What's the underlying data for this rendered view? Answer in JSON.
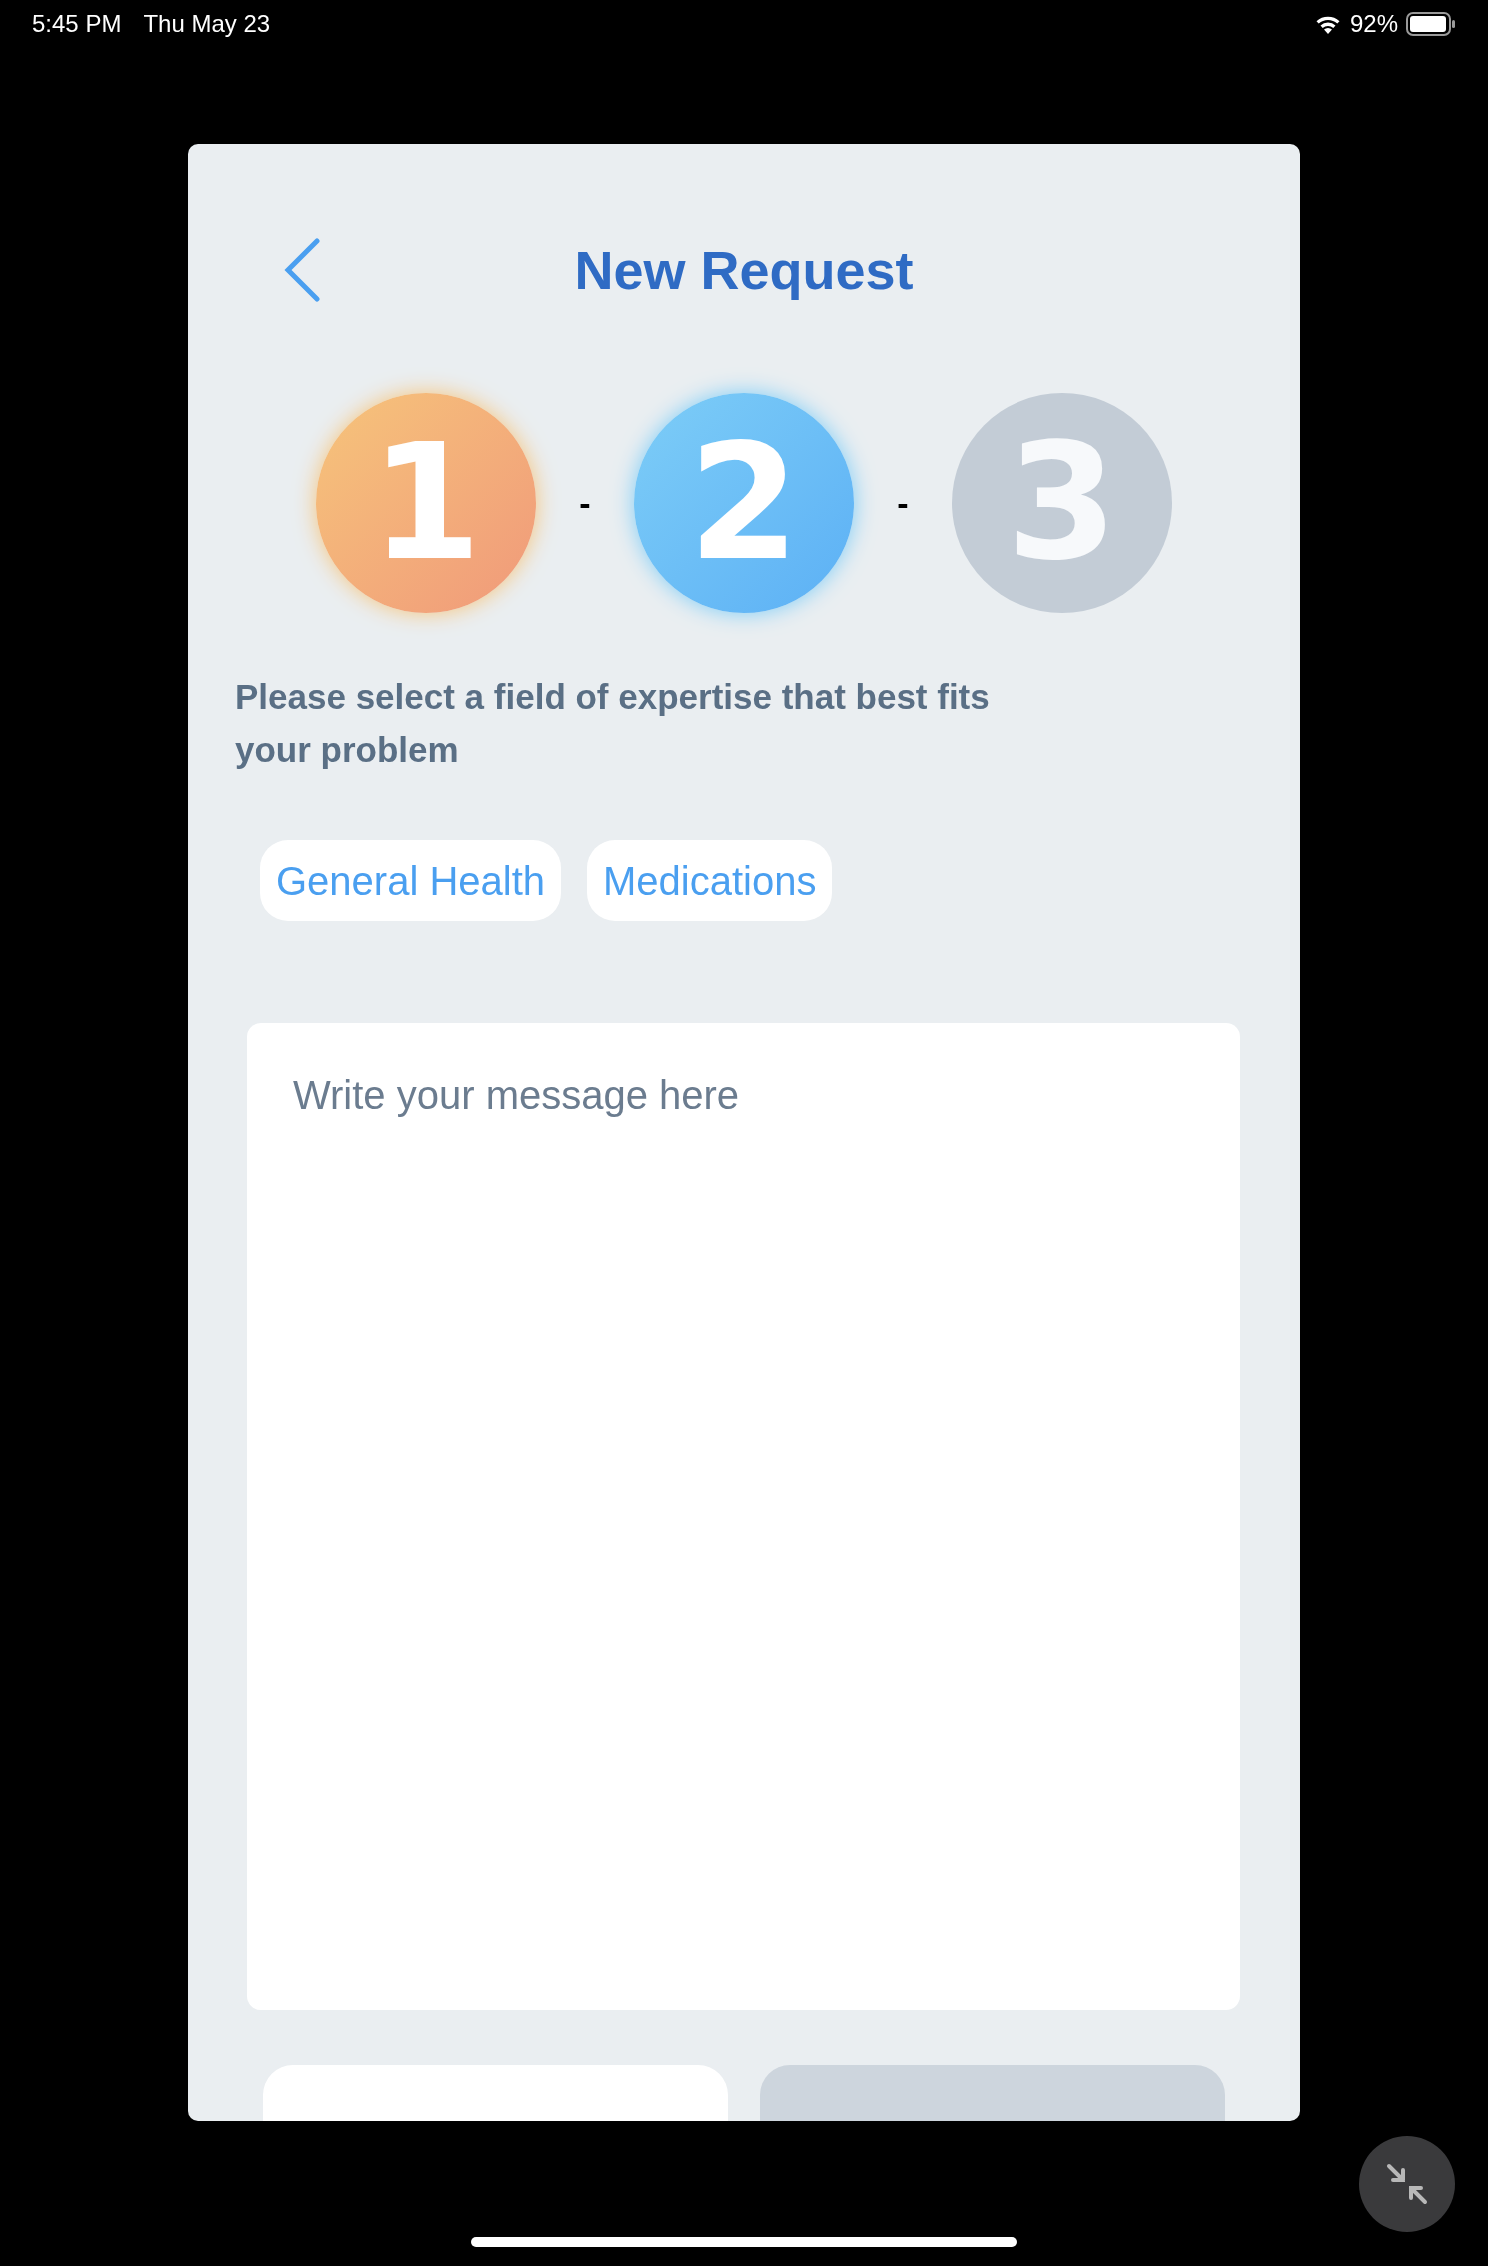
{
  "status_bar": {
    "time": "5:45 PM",
    "date": "Thu May 23",
    "battery": "92%"
  },
  "header": {
    "title": "New Request"
  },
  "steps": [
    {
      "label": "1",
      "kind": "done"
    },
    {
      "label": "2",
      "kind": "current"
    },
    {
      "label": "3",
      "kind": "pending"
    }
  ],
  "step_separators": [
    "-",
    "-"
  ],
  "prompt": "Please select a field of expertise that best fits your problem",
  "chips": [
    {
      "label": "General Health"
    },
    {
      "label": "Medications"
    }
  ],
  "message": {
    "placeholder": "Write your message here"
  },
  "bottom_buttons": [
    {
      "disabled": false
    },
    {
      "disabled": true
    }
  ]
}
